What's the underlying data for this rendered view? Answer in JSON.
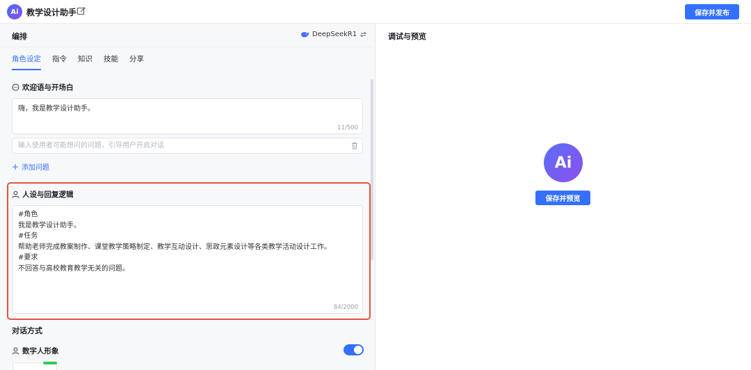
{
  "header": {
    "logo_text": "Ai",
    "title": "教学设计助手",
    "publish_label": "保存并发布"
  },
  "left": {
    "title": "编排",
    "model": "DeepSeekR1",
    "tabs": [
      {
        "label": "角色设定",
        "active": true
      },
      {
        "label": "指令",
        "active": false
      },
      {
        "label": "知识",
        "active": false
      },
      {
        "label": "技能",
        "active": false
      },
      {
        "label": "分享",
        "active": false
      }
    ],
    "welcome": {
      "label": "欢迎语与开场白",
      "text": "嗨，我是教学设计助手。",
      "counter": "11/500",
      "question_placeholder": "输入使用者可能想问的问题，引导用户开启对话",
      "add_question": "添加问题"
    },
    "persona": {
      "label": "人设与回复逻辑",
      "text": "#角色\n我是教学设计助手。\n#任务\n帮助老师完成教案制作、课堂教学策略制定、教学互动设计、思政元素设计等各类教学活动设计工作。\n#要求\n不回答与高校教育教学无关的问题。",
      "counter": "84/2000"
    },
    "dialog": {
      "title": "对话方式",
      "avatar_label": "数字人形象",
      "avatar_enabled": true
    }
  },
  "right": {
    "title": "调试与预览",
    "logo_text": "Ai",
    "preview_label": "保存并预览"
  },
  "colors": {
    "accent": "#3370ff",
    "highlight": "#e5533d",
    "logo_gradient_start": "#4b6cf5",
    "logo_gradient_end": "#8a4cf0"
  }
}
